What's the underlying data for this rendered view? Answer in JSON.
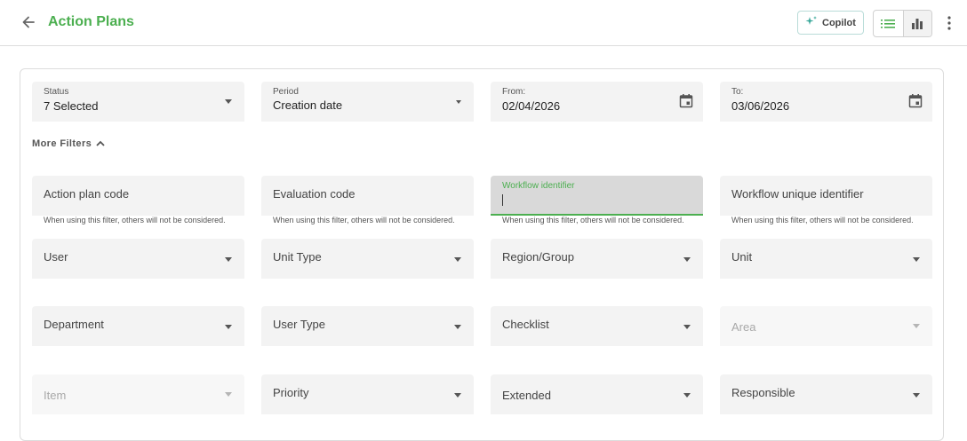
{
  "header": {
    "title": "Action Plans",
    "copilot_label": "Copilot"
  },
  "filters": {
    "status": {
      "label": "Status",
      "value": "7 Selected"
    },
    "period": {
      "label": "Period",
      "value": "Creation date"
    },
    "from": {
      "label": "From:",
      "value": "02/04/2026"
    },
    "to": {
      "label": "To:",
      "value": "03/06/2026"
    },
    "more_filters": "More Filters",
    "action_plan_code": "Action plan code",
    "evaluation_code": "Evaluation code",
    "workflow_identifier": "Workflow identifier",
    "workflow_unique_identifier": "Workflow unique identifier",
    "hint": "When using this filter, others will not be considered.",
    "user": "User",
    "unit_type": "Unit Type",
    "region_group": "Region/Group",
    "unit": "Unit",
    "department": "Department",
    "user_type": "User Type",
    "checklist": "Checklist",
    "area": "Area",
    "item": "Item",
    "priority": "Priority",
    "extended": "Extended",
    "responsible": "Responsible"
  },
  "colors": {
    "accent": "#4caf50",
    "field_bg": "#f3f3f3",
    "active_field_bg": "#d9d9d9"
  },
  "icons": [
    "arrow-left-icon",
    "sparkle-icon",
    "list-view-icon",
    "bar-chart-icon",
    "kebab-menu-icon",
    "calendar-icon",
    "chevron-up-icon",
    "dropdown-caret-icon"
  ]
}
